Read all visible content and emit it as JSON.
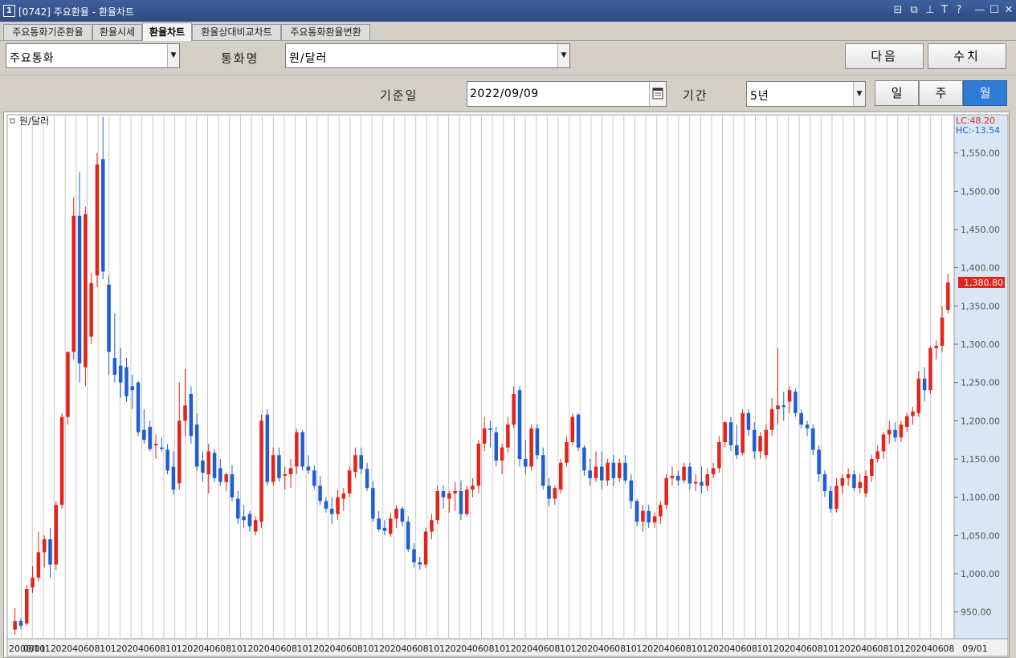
{
  "window": {
    "number_icon": "1",
    "title": "[0742] 주요환율 - 환율차트",
    "buttons": [
      "restore-small-icon",
      "cascade-icon",
      "pin-icon",
      "text-icon",
      "help-icon",
      "minimize-icon",
      "maximize-icon",
      "close-icon"
    ],
    "button_glyphs": [
      "⊟",
      "⧉",
      "⊥",
      "T",
      "?",
      "—",
      "☐",
      "✕"
    ]
  },
  "tabs": [
    {
      "label": "주요통화기준환율",
      "active": false
    },
    {
      "label": "환율시세",
      "active": false
    },
    {
      "label": "환율차트",
      "active": true
    },
    {
      "label": "환율상대비교차트",
      "active": false
    },
    {
      "label": "주요통화환율변환",
      "active": false
    }
  ],
  "controls": {
    "group_select": "주요통화",
    "currency_label": "통화명",
    "currency_select": "원/달러",
    "next_button": "다음",
    "values_button": "수치",
    "base_date_label": "기준일",
    "base_date": "2022/09/09",
    "period_label": "기간",
    "period_select": "5년",
    "interval_buttons": [
      {
        "label": "일",
        "active": false
      },
      {
        "label": "주",
        "active": false
      },
      {
        "label": "월",
        "active": true
      }
    ]
  },
  "chart_data": {
    "type": "candlestick",
    "legend": "원/달러",
    "lc_label": "LC:48.20",
    "hc_label": "HC:-13.54",
    "last_value_label": "1,380.80",
    "last_value": 1380.8,
    "ylim": [
      915,
      1600
    ],
    "y_ticks": [
      950,
      1000,
      1050,
      1100,
      1150,
      1200,
      1250,
      1300,
      1350,
      1400,
      1450,
      1500,
      1550
    ],
    "y_tick_labels": [
      "950.00",
      "1,000.00",
      "1,050.00",
      "1,100.00",
      "1,150.00",
      "1,200.00",
      "1,250.00",
      "1,300.00",
      "1,350.00",
      "1,400.00",
      "1,450.00",
      "1,500.00",
      "1,550.00"
    ],
    "x_tick_labels": [
      "2008/01",
      "08",
      "10",
      "12",
      "02",
      "04",
      "06",
      "08",
      "10",
      "12",
      "02",
      "04",
      "06",
      "08",
      "10",
      "12",
      "02",
      "04",
      "06",
      "08",
      "10",
      "12",
      "02",
      "04",
      "06",
      "08",
      "10",
      "12",
      "02",
      "04",
      "06",
      "08",
      "10",
      "12",
      "02",
      "04",
      "06",
      "08",
      "10",
      "12",
      "02",
      "04",
      "06",
      "08",
      "10",
      "12",
      "02",
      "04",
      "06",
      "08",
      "10",
      "12",
      "02",
      "04",
      "06",
      "08",
      "10",
      "12",
      "02",
      "04",
      "06",
      "08",
      "10",
      "12",
      "02",
      "04",
      "06",
      "08",
      "10",
      "12",
      "02",
      "04",
      "06",
      "08",
      "10",
      "12",
      "02",
      "04",
      "06",
      "08",
      "10",
      "12",
      "02",
      "04",
      "06",
      "08"
    ],
    "x_right_label": "09/01",
    "colors": {
      "up": "#e4231b",
      "down": "#1f5fd0",
      "grid": "#c8c8c8",
      "axis_bg": "#d9e6f3",
      "lc": "#e4231b",
      "hc": "#1f5fd0"
    },
    "candles": [
      {
        "o": 927,
        "h": 955,
        "l": 920,
        "c": 938
      },
      {
        "o": 938,
        "h": 942,
        "l": 928,
        "c": 932
      },
      {
        "o": 935,
        "h": 985,
        "l": 932,
        "c": 980
      },
      {
        "o": 982,
        "h": 1010,
        "l": 975,
        "c": 995
      },
      {
        "o": 995,
        "h": 1055,
        "l": 990,
        "c": 1028
      },
      {
        "o": 1028,
        "h": 1050,
        "l": 1008,
        "c": 1045
      },
      {
        "o": 1045,
        "h": 1060,
        "l": 995,
        "c": 1012
      },
      {
        "o": 1012,
        "h": 1095,
        "l": 1005,
        "c": 1090
      },
      {
        "o": 1090,
        "h": 1210,
        "l": 1085,
        "c": 1205
      },
      {
        "o": 1205,
        "h": 1250,
        "l": 1195,
        "c": 1290
      },
      {
        "o": 1290,
        "h": 1492,
        "l": 1280,
        "c": 1468
      },
      {
        "o": 1468,
        "h": 1525,
        "l": 1250,
        "c": 1275
      },
      {
        "o": 1270,
        "h": 1480,
        "l": 1245,
        "c": 1470
      },
      {
        "o": 1310,
        "h": 1393,
        "l": 1300,
        "c": 1380
      },
      {
        "o": 1390,
        "h": 1550,
        "l": 1375,
        "c": 1535
      },
      {
        "o": 1542,
        "h": 1597,
        "l": 1385,
        "c": 1395
      },
      {
        "o": 1378,
        "h": 1390,
        "l": 1260,
        "c": 1290
      },
      {
        "o": 1282,
        "h": 1340,
        "l": 1250,
        "c": 1260
      },
      {
        "o": 1272,
        "h": 1295,
        "l": 1230,
        "c": 1250
      },
      {
        "o": 1270,
        "h": 1282,
        "l": 1225,
        "c": 1232
      },
      {
        "o": 1245,
        "h": 1260,
        "l": 1215,
        "c": 1240
      },
      {
        "o": 1250,
        "h": 1252,
        "l": 1180,
        "c": 1185
      },
      {
        "o": 1188,
        "h": 1215,
        "l": 1170,
        "c": 1175
      },
      {
        "o": 1192,
        "h": 1200,
        "l": 1160,
        "c": 1163
      },
      {
        "o": 1168,
        "h": 1182,
        "l": 1150,
        "c": 1170
      },
      {
        "o": 1165,
        "h": 1178,
        "l": 1160,
        "c": 1163
      },
      {
        "o": 1162,
        "h": 1170,
        "l": 1130,
        "c": 1135
      },
      {
        "o": 1140,
        "h": 1160,
        "l": 1103,
        "c": 1110
      },
      {
        "o": 1118,
        "h": 1250,
        "l": 1110,
        "c": 1200
      },
      {
        "o": 1200,
        "h": 1268,
        "l": 1180,
        "c": 1220
      },
      {
        "o": 1235,
        "h": 1245,
        "l": 1170,
        "c": 1180
      },
      {
        "o": 1195,
        "h": 1210,
        "l": 1135,
        "c": 1140
      },
      {
        "o": 1148,
        "h": 1160,
        "l": 1120,
        "c": 1132
      },
      {
        "o": 1130,
        "h": 1170,
        "l": 1105,
        "c": 1160
      },
      {
        "o": 1158,
        "h": 1163,
        "l": 1120,
        "c": 1125
      },
      {
        "o": 1138,
        "h": 1150,
        "l": 1115,
        "c": 1120
      },
      {
        "o": 1120,
        "h": 1132,
        "l": 1108,
        "c": 1130
      },
      {
        "o": 1130,
        "h": 1142,
        "l": 1095,
        "c": 1100
      },
      {
        "o": 1098,
        "h": 1108,
        "l": 1065,
        "c": 1072
      },
      {
        "o": 1075,
        "h": 1090,
        "l": 1060,
        "c": 1070
      },
      {
        "o": 1078,
        "h": 1082,
        "l": 1055,
        "c": 1062
      },
      {
        "o": 1055,
        "h": 1075,
        "l": 1050,
        "c": 1070
      },
      {
        "o": 1068,
        "h": 1208,
        "l": 1060,
        "c": 1200
      },
      {
        "o": 1208,
        "h": 1215,
        "l": 1115,
        "c": 1120
      },
      {
        "o": 1120,
        "h": 1165,
        "l": 1115,
        "c": 1155
      },
      {
        "o": 1155,
        "h": 1165,
        "l": 1120,
        "c": 1125
      },
      {
        "o": 1128,
        "h": 1140,
        "l": 1110,
        "c": 1130
      },
      {
        "o": 1130,
        "h": 1150,
        "l": 1112,
        "c": 1138
      },
      {
        "o": 1140,
        "h": 1190,
        "l": 1130,
        "c": 1185
      },
      {
        "o": 1185,
        "h": 1188,
        "l": 1135,
        "c": 1140
      },
      {
        "o": 1140,
        "h": 1155,
        "l": 1130,
        "c": 1135
      },
      {
        "o": 1135,
        "h": 1142,
        "l": 1110,
        "c": 1115
      },
      {
        "o": 1115,
        "h": 1128,
        "l": 1090,
        "c": 1095
      },
      {
        "o": 1095,
        "h": 1100,
        "l": 1080,
        "c": 1085
      },
      {
        "o": 1085,
        "h": 1100,
        "l": 1065,
        "c": 1078
      },
      {
        "o": 1078,
        "h": 1110,
        "l": 1070,
        "c": 1100
      },
      {
        "o": 1098,
        "h": 1112,
        "l": 1082,
        "c": 1105
      },
      {
        "o": 1105,
        "h": 1140,
        "l": 1100,
        "c": 1135
      },
      {
        "o": 1133,
        "h": 1165,
        "l": 1125,
        "c": 1155
      },
      {
        "o": 1155,
        "h": 1165,
        "l": 1130,
        "c": 1137
      },
      {
        "o": 1137,
        "h": 1145,
        "l": 1108,
        "c": 1112
      },
      {
        "o": 1112,
        "h": 1120,
        "l": 1068,
        "c": 1072
      },
      {
        "o": 1072,
        "h": 1082,
        "l": 1055,
        "c": 1058
      },
      {
        "o": 1060,
        "h": 1070,
        "l": 1050,
        "c": 1056
      },
      {
        "o": 1052,
        "h": 1080,
        "l": 1048,
        "c": 1072
      },
      {
        "o": 1072,
        "h": 1090,
        "l": 1060,
        "c": 1085
      },
      {
        "o": 1085,
        "h": 1088,
        "l": 1062,
        "c": 1068
      },
      {
        "o": 1068,
        "h": 1075,
        "l": 1028,
        "c": 1032
      },
      {
        "o": 1032,
        "h": 1040,
        "l": 1008,
        "c": 1015
      },
      {
        "o": 1015,
        "h": 1022,
        "l": 1005,
        "c": 1012
      },
      {
        "o": 1012,
        "h": 1060,
        "l": 1008,
        "c": 1055
      },
      {
        "o": 1055,
        "h": 1078,
        "l": 1045,
        "c": 1070
      },
      {
        "o": 1070,
        "h": 1115,
        "l": 1065,
        "c": 1108
      },
      {
        "o": 1108,
        "h": 1115,
        "l": 1085,
        "c": 1100
      },
      {
        "o": 1098,
        "h": 1108,
        "l": 1080,
        "c": 1105
      },
      {
        "o": 1105,
        "h": 1120,
        "l": 1082,
        "c": 1108
      },
      {
        "o": 1108,
        "h": 1122,
        "l": 1070,
        "c": 1078
      },
      {
        "o": 1078,
        "h": 1115,
        "l": 1075,
        "c": 1110
      },
      {
        "o": 1110,
        "h": 1125,
        "l": 1100,
        "c": 1115
      },
      {
        "o": 1115,
        "h": 1175,
        "l": 1105,
        "c": 1170
      },
      {
        "o": 1170,
        "h": 1205,
        "l": 1160,
        "c": 1190
      },
      {
        "o": 1190,
        "h": 1200,
        "l": 1165,
        "c": 1188
      },
      {
        "o": 1185,
        "h": 1192,
        "l": 1140,
        "c": 1148
      },
      {
        "o": 1148,
        "h": 1170,
        "l": 1130,
        "c": 1165
      },
      {
        "o": 1165,
        "h": 1205,
        "l": 1158,
        "c": 1195
      },
      {
        "o": 1195,
        "h": 1245,
        "l": 1190,
        "c": 1235
      },
      {
        "o": 1240,
        "h": 1245,
        "l": 1140,
        "c": 1150
      },
      {
        "o": 1150,
        "h": 1175,
        "l": 1130,
        "c": 1140
      },
      {
        "o": 1140,
        "h": 1195,
        "l": 1135,
        "c": 1190
      },
      {
        "o": 1190,
        "h": 1195,
        "l": 1150,
        "c": 1155
      },
      {
        "o": 1155,
        "h": 1165,
        "l": 1110,
        "c": 1115
      },
      {
        "o": 1115,
        "h": 1125,
        "l": 1088,
        "c": 1098
      },
      {
        "o": 1098,
        "h": 1115,
        "l": 1090,
        "c": 1112
      },
      {
        "o": 1110,
        "h": 1150,
        "l": 1105,
        "c": 1145
      },
      {
        "o": 1145,
        "h": 1180,
        "l": 1140,
        "c": 1172
      },
      {
        "o": 1172,
        "h": 1210,
        "l": 1168,
        "c": 1205
      },
      {
        "o": 1208,
        "h": 1210,
        "l": 1160,
        "c": 1165
      },
      {
        "o": 1165,
        "h": 1168,
        "l": 1128,
        "c": 1135
      },
      {
        "o": 1135,
        "h": 1150,
        "l": 1115,
        "c": 1125
      },
      {
        "o": 1125,
        "h": 1160,
        "l": 1120,
        "c": 1140
      },
      {
        "o": 1140,
        "h": 1160,
        "l": 1110,
        "c": 1122
      },
      {
        "o": 1122,
        "h": 1150,
        "l": 1115,
        "c": 1145
      },
      {
        "o": 1145,
        "h": 1155,
        "l": 1115,
        "c": 1125
      },
      {
        "o": 1125,
        "h": 1150,
        "l": 1120,
        "c": 1145
      },
      {
        "o": 1145,
        "h": 1155,
        "l": 1118,
        "c": 1122
      },
      {
        "o": 1122,
        "h": 1130,
        "l": 1085,
        "c": 1095
      },
      {
        "o": 1095,
        "h": 1098,
        "l": 1062,
        "c": 1068
      },
      {
        "o": 1068,
        "h": 1090,
        "l": 1055,
        "c": 1082
      },
      {
        "o": 1082,
        "h": 1090,
        "l": 1060,
        "c": 1067
      },
      {
        "o": 1067,
        "h": 1080,
        "l": 1060,
        "c": 1075
      },
      {
        "o": 1075,
        "h": 1095,
        "l": 1065,
        "c": 1090
      },
      {
        "o": 1090,
        "h": 1130,
        "l": 1085,
        "c": 1125
      },
      {
        "o": 1125,
        "h": 1140,
        "l": 1115,
        "c": 1128
      },
      {
        "o": 1128,
        "h": 1135,
        "l": 1115,
        "c": 1122
      },
      {
        "o": 1122,
        "h": 1145,
        "l": 1118,
        "c": 1140
      },
      {
        "o": 1140,
        "h": 1145,
        "l": 1110,
        "c": 1118
      },
      {
        "o": 1118,
        "h": 1130,
        "l": 1108,
        "c": 1120
      },
      {
        "o": 1120,
        "h": 1140,
        "l": 1105,
        "c": 1115
      },
      {
        "o": 1115,
        "h": 1138,
        "l": 1108,
        "c": 1130
      },
      {
        "o": 1130,
        "h": 1145,
        "l": 1125,
        "c": 1138
      },
      {
        "o": 1138,
        "h": 1180,
        "l": 1132,
        "c": 1172
      },
      {
        "o": 1172,
        "h": 1200,
        "l": 1165,
        "c": 1198
      },
      {
        "o": 1198,
        "h": 1205,
        "l": 1160,
        "c": 1168
      },
      {
        "o": 1168,
        "h": 1195,
        "l": 1150,
        "c": 1155
      },
      {
        "o": 1158,
        "h": 1215,
        "l": 1155,
        "c": 1210
      },
      {
        "o": 1210,
        "h": 1215,
        "l": 1180,
        "c": 1188
      },
      {
        "o": 1188,
        "h": 1198,
        "l": 1150,
        "c": 1160
      },
      {
        "o": 1160,
        "h": 1185,
        "l": 1150,
        "c": 1180
      },
      {
        "o": 1155,
        "h": 1195,
        "l": 1150,
        "c": 1188
      },
      {
        "o": 1188,
        "h": 1230,
        "l": 1180,
        "c": 1215
      },
      {
        "o": 1215,
        "h": 1295,
        "l": 1195,
        "c": 1220
      },
      {
        "o": 1220,
        "h": 1238,
        "l": 1200,
        "c": 1218
      },
      {
        "o": 1225,
        "h": 1245,
        "l": 1210,
        "c": 1240
      },
      {
        "o": 1238,
        "h": 1242,
        "l": 1205,
        "c": 1210
      },
      {
        "o": 1210,
        "h": 1215,
        "l": 1190,
        "c": 1195
      },
      {
        "o": 1195,
        "h": 1200,
        "l": 1180,
        "c": 1190
      },
      {
        "o": 1190,
        "h": 1195,
        "l": 1155,
        "c": 1162
      },
      {
        "o": 1162,
        "h": 1168,
        "l": 1120,
        "c": 1130
      },
      {
        "o": 1130,
        "h": 1135,
        "l": 1100,
        "c": 1108
      },
      {
        "o": 1108,
        "h": 1115,
        "l": 1080,
        "c": 1085
      },
      {
        "o": 1085,
        "h": 1125,
        "l": 1080,
        "c": 1115
      },
      {
        "o": 1115,
        "h": 1130,
        "l": 1105,
        "c": 1125
      },
      {
        "o": 1125,
        "h": 1138,
        "l": 1115,
        "c": 1130
      },
      {
        "o": 1130,
        "h": 1135,
        "l": 1108,
        "c": 1112
      },
      {
        "o": 1112,
        "h": 1130,
        "l": 1105,
        "c": 1120
      },
      {
        "o": 1105,
        "h": 1135,
        "l": 1100,
        "c": 1128
      },
      {
        "o": 1128,
        "h": 1155,
        "l": 1120,
        "c": 1150
      },
      {
        "o": 1150,
        "h": 1168,
        "l": 1145,
        "c": 1160
      },
      {
        "o": 1160,
        "h": 1185,
        "l": 1150,
        "c": 1182
      },
      {
        "o": 1182,
        "h": 1200,
        "l": 1170,
        "c": 1188
      },
      {
        "o": 1188,
        "h": 1198,
        "l": 1172,
        "c": 1178
      },
      {
        "o": 1178,
        "h": 1200,
        "l": 1172,
        "c": 1195
      },
      {
        "o": 1192,
        "h": 1210,
        "l": 1185,
        "c": 1206
      },
      {
        "o": 1206,
        "h": 1218,
        "l": 1195,
        "c": 1212
      },
      {
        "o": 1210,
        "h": 1265,
        "l": 1205,
        "c": 1255
      },
      {
        "o": 1255,
        "h": 1270,
        "l": 1225,
        "c": 1240
      },
      {
        "o": 1240,
        "h": 1298,
        "l": 1235,
        "c": 1295
      },
      {
        "o": 1295,
        "h": 1305,
        "l": 1280,
        "c": 1298
      },
      {
        "o": 1298,
        "h": 1350,
        "l": 1290,
        "c": 1335
      },
      {
        "o": 1345,
        "h": 1392,
        "l": 1340,
        "c": 1380.8
      }
    ]
  }
}
